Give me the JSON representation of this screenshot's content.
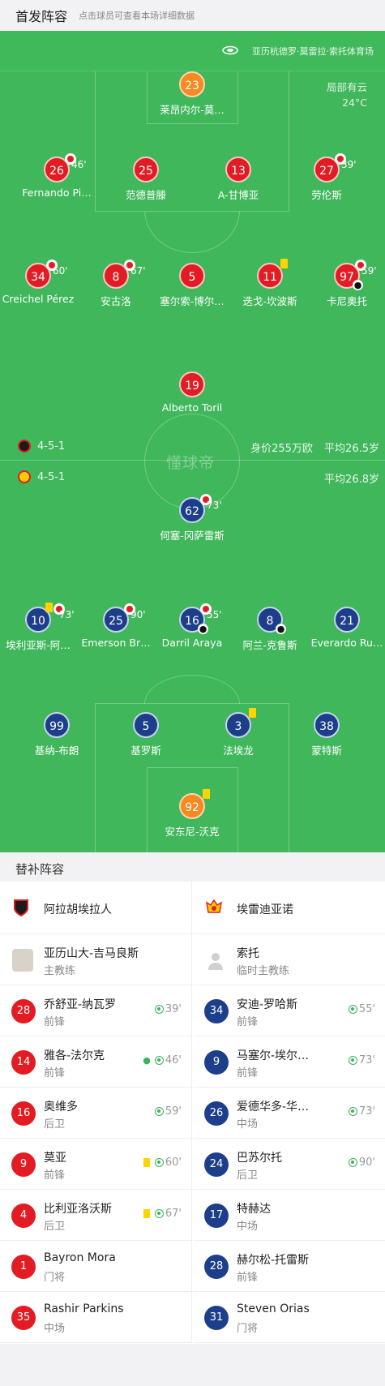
{
  "header": {
    "title": "首发阵容",
    "hint": "点击球员可查看本场详细数据"
  },
  "stadium": {
    "name": "亚历杭德罗·莫雷拉·索托体育场",
    "icon": "stadium-icon"
  },
  "weather": {
    "condition": "局部有云",
    "temp": "24°C"
  },
  "home_team": {
    "formation": "4-5-1",
    "value": "身价255万欧",
    "avg_age": "平均26.5岁",
    "colors": {
      "shirt": "#e31c23",
      "gk": "#f6891f"
    },
    "players": [
      {
        "num": "23",
        "name": "莱昂内尔-莫…",
        "gk": true
      },
      {
        "num": "26",
        "name": "Fernando Pi…",
        "sub_out": "46'"
      },
      {
        "num": "25",
        "name": "范德普滕"
      },
      {
        "num": "13",
        "name": "A-甘博亚"
      },
      {
        "num": "27",
        "name": "劳伦斯",
        "sub_out": "39'"
      },
      {
        "num": "34",
        "name": "Creichel Pérez",
        "sub_out": "60'"
      },
      {
        "num": "8",
        "name": "安古洛",
        "sub_out": "67'"
      },
      {
        "num": "5",
        "name": "塞尔索-博尔…"
      },
      {
        "num": "11",
        "name": "迭戈-坎波斯",
        "yellow": true
      },
      {
        "num": "97",
        "name": "卡尼奥托",
        "sub_out": "59'",
        "goal": true
      },
      {
        "num": "19",
        "name": "Alberto Toril"
      }
    ]
  },
  "away_team": {
    "formation": "4-5-1",
    "avg_age": "平均26.8岁",
    "colors": {
      "shirt": "#1d3f8b",
      "gk": "#f6891f"
    },
    "players": [
      {
        "num": "62",
        "name": "何塞-冈萨雷斯",
        "sub_out": "73'"
      },
      {
        "num": "10",
        "name": "埃利亚斯-阿…",
        "sub_out": "73'",
        "yellow": true
      },
      {
        "num": "25",
        "name": "Emerson Br…",
        "sub_out": "90'"
      },
      {
        "num": "16",
        "name": "Darril Araya",
        "sub_out": "55'",
        "goal": true
      },
      {
        "num": "8",
        "name": "阿兰-克鲁斯",
        "goal": true
      },
      {
        "num": "21",
        "name": "Everardo Ru…"
      },
      {
        "num": "99",
        "name": "基纳-布朗"
      },
      {
        "num": "5",
        "name": "基罗斯"
      },
      {
        "num": "3",
        "name": "法埃龙",
        "yellow": true
      },
      {
        "num": "38",
        "name": "蒙特斯"
      },
      {
        "num": "92",
        "name": "安东尼-沃克",
        "gk": true,
        "yellow": true
      }
    ]
  },
  "watermark": "懂球帝",
  "subs": {
    "title": "替补阵容",
    "home": {
      "team": "阿拉胡埃拉人",
      "coach": {
        "name": "亚历山大-吉马良斯",
        "role": "主教练"
      },
      "players": [
        {
          "num": "28",
          "name": "乔舒亚-纳瓦罗",
          "pos": "前锋",
          "in": "39'"
        },
        {
          "num": "14",
          "name": "雅各-法尔克",
          "pos": "前锋",
          "in": "46'",
          "goal": true
        },
        {
          "num": "16",
          "name": "奥维多",
          "pos": "后卫",
          "in": "59'"
        },
        {
          "num": "9",
          "name": "莫亚",
          "pos": "前锋",
          "in": "60'",
          "yellow": true
        },
        {
          "num": "4",
          "name": "比利亚洛沃斯",
          "pos": "后卫",
          "in": "67'",
          "yellow": true
        },
        {
          "num": "1",
          "name": "Bayron Mora",
          "pos": "门将"
        },
        {
          "num": "35",
          "name": "Rashir Parkins",
          "pos": "中场"
        }
      ]
    },
    "away": {
      "team": "埃雷迪亚诺",
      "coach": {
        "name": "索托",
        "role": "临时主教练"
      },
      "players": [
        {
          "num": "34",
          "name": "安迪-罗哈斯",
          "pos": "前锋",
          "in": "55'"
        },
        {
          "num": "9",
          "name": "马塞尔-埃尔…",
          "pos": "前锋",
          "in": "73'"
        },
        {
          "num": "26",
          "name": "爱德华多-华…",
          "pos": "中场",
          "in": "73'"
        },
        {
          "num": "24",
          "name": "巴苏尔托",
          "pos": "后卫",
          "in": "90'"
        },
        {
          "num": "17",
          "name": "特赫达",
          "pos": "中场"
        },
        {
          "num": "28",
          "name": "赫尔松-托雷斯",
          "pos": "前锋"
        },
        {
          "num": "31",
          "name": "Steven Orias",
          "pos": "门将"
        }
      ]
    }
  }
}
